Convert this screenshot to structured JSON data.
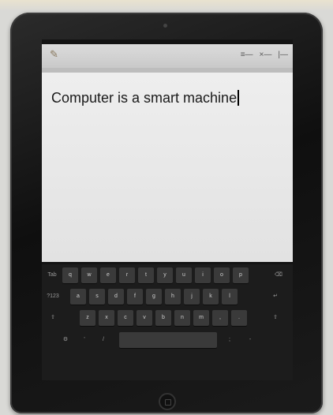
{
  "document": {
    "text": "Computer is a smart machine"
  },
  "titlebar": {
    "app_icon": "pen-icon",
    "controls": [
      "≡—",
      "×—",
      "|—"
    ]
  },
  "ribbon": {
    "label": ""
  },
  "keyboard": {
    "row1": [
      "Tab",
      "q",
      "w",
      "e",
      "r",
      "t",
      "y",
      "u",
      "i",
      "o",
      "p",
      "⌫"
    ],
    "row2": [
      "?123",
      "a",
      "s",
      "d",
      "f",
      "g",
      "h",
      "j",
      "k",
      "l",
      "↵"
    ],
    "row3": [
      "⇧",
      "z",
      "x",
      "c",
      "v",
      "b",
      "n",
      "m",
      ",",
      ".",
      "⇧"
    ],
    "row4": [
      "⚙",
      "'",
      "/",
      "",
      ";",
      "-"
    ]
  },
  "colors": {
    "tablet_bezel": "#141414",
    "document_bg": "#eeeeee",
    "key_bg": "#3a3a3a"
  }
}
